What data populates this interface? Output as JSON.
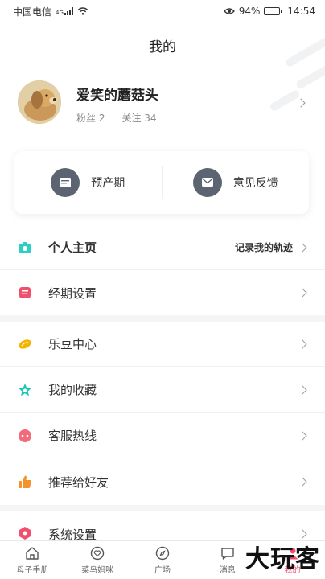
{
  "status_bar": {
    "carrier": "中国电信",
    "network": "4G",
    "battery_percent": "94%",
    "battery_level": 0.94,
    "time": "14:54"
  },
  "header": {
    "title": "我的"
  },
  "profile": {
    "username": "爱笑的蘑菇头",
    "fans": "粉丝 2",
    "following": "关注 34"
  },
  "quick_card": {
    "items": [
      {
        "label": "预产期",
        "icon": "calendar-icon"
      },
      {
        "label": "意见反馈",
        "icon": "mail-icon"
      }
    ]
  },
  "menu": {
    "home": {
      "label": "个人主页",
      "right_text": "记录我的轨迹",
      "icon_color": "#2ecfc4"
    },
    "period": {
      "label": "经期设置",
      "icon_color": "#f0506e"
    },
    "ledou": {
      "label": "乐豆中心",
      "icon_color": "#f5b400"
    },
    "favorites": {
      "label": "我的收藏",
      "icon_color": "#1ec4b8"
    },
    "service": {
      "label": "客服热线",
      "icon_color": "#f26b7b"
    },
    "recommend": {
      "label": "推荐给好友",
      "icon_color": "#f5922a"
    },
    "settings": {
      "label": "系统设置",
      "icon_color": "#f0506e"
    }
  },
  "tabbar": {
    "tabs": [
      {
        "label": "母子手册",
        "icon": "home-icon"
      },
      {
        "label": "菜鸟妈咪",
        "icon": "heart-icon"
      },
      {
        "label": "广场",
        "icon": "compass-icon"
      },
      {
        "label": "消息",
        "icon": "message-icon"
      },
      {
        "label": "我的",
        "icon": "user-icon"
      }
    ]
  },
  "watermark": "大玩客"
}
